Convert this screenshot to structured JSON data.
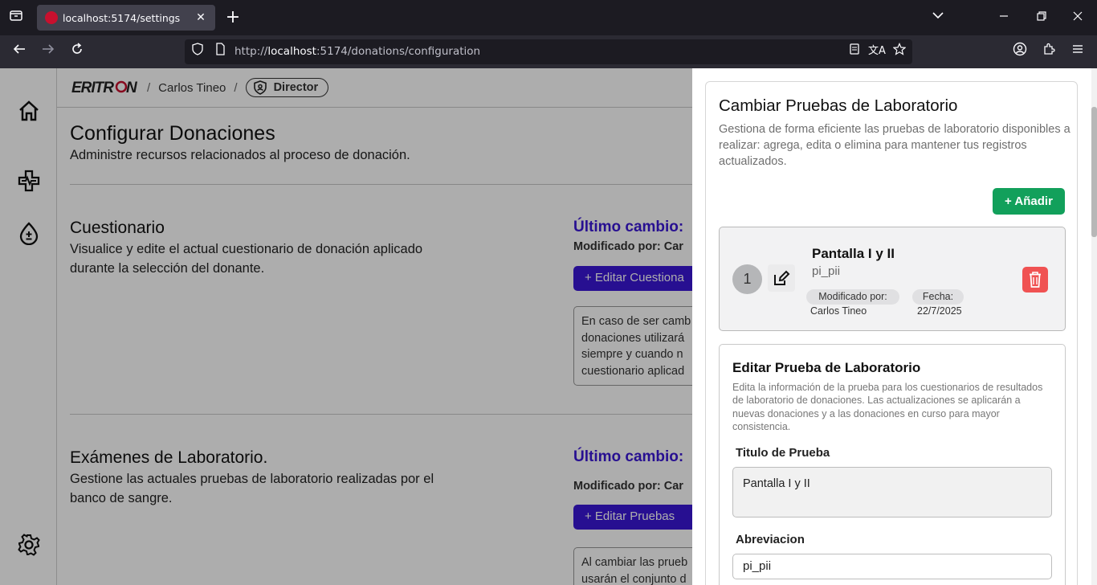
{
  "browser": {
    "tab_title": "localhost:5174/settings",
    "url_prefix": "http://",
    "url_host": "localhost",
    "url_rest": ":5174/donations/configuration"
  },
  "header": {
    "logo_text": "ERITRON",
    "user_name": "Carlos Tineo",
    "separator": "/",
    "role": "Director"
  },
  "page": {
    "title": "Configurar Donaciones",
    "subtitle": "Administre recursos relacionados al proceso de donación."
  },
  "sections": [
    {
      "title": "Cuestionario",
      "description": "Visualice y edite el actual cuestionario de donación aplicado durante la selección del donante.",
      "last_change_label": "Último cambio:",
      "modified_by_label": "Modificado por: Car",
      "button_label": "+ Editar Cuestiona",
      "note_lines": [
        "En caso de ser camb",
        "donaciones utilizará",
        "siempre y cuando n",
        "cuestionario aplicad"
      ]
    },
    {
      "title": "Exámenes de Laboratorio.",
      "description": "Gestione las actuales pruebas de laboratorio realizadas por el banco de sangre.",
      "last_change_label": "Último cambio:",
      "modified_by_label": "Modificado por: Car",
      "button_label": "+ Editar Pruebas",
      "note_lines": [
        "Al cambiar las prueb",
        "usarán el conjunto d"
      ]
    }
  ],
  "drawer": {
    "title": "Cambiar Pruebas de Laboratorio",
    "description": "Gestiona de forma eficiente las pruebas de laboratorio disponibles a realizar: agrega, edita o elimina para mantener tus registros actualizados.",
    "add_button": "+ Añadir",
    "item": {
      "number": "1",
      "name": "Pantalla I y II",
      "abbreviation": "pi_pii",
      "modified_label": "Modificado por:",
      "modified_value": "Carlos Tineo",
      "date_label": "Fecha:",
      "date_value": "22/7/2025"
    },
    "form": {
      "title": "Editar Prueba de Laboratorio",
      "description": "Edita la información de la prueba para los cuestionarios de resultados de laboratorio de donaciones. Las actualizaciones se aplicarán a nuevas donaciones y a las donaciones en curso para mayor consistencia.",
      "title_label": "Titulo de Prueba",
      "title_value": "Pantalla I y II",
      "abbr_label": "Abreviacion",
      "abbr_value": "pi_pii"
    }
  },
  "colors": {
    "accent_purple": "#3a17d6",
    "add_green": "#12a05b",
    "delete_red": "#f05252"
  }
}
